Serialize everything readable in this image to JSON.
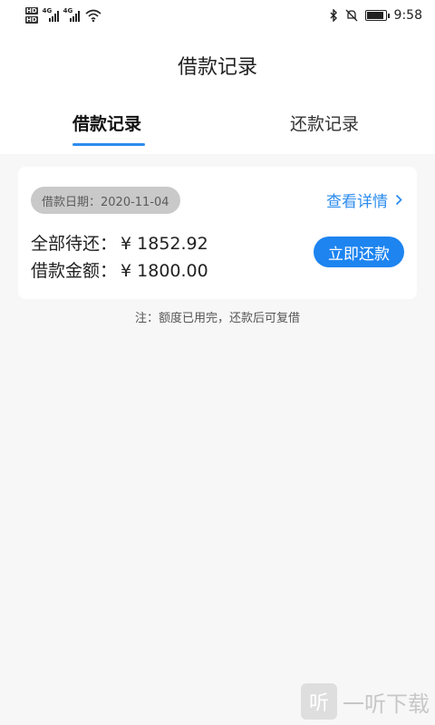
{
  "status_bar": {
    "time": "9:58",
    "left_icons": [
      "hd-icon",
      "signal-4g-icon",
      "signal-4g-icon",
      "wifi-icon"
    ],
    "right_icons": [
      "bluetooth-icon",
      "mute-bell-icon",
      "battery-icon"
    ],
    "network_label": "4G"
  },
  "header": {
    "title": "借款记录",
    "tabs": [
      {
        "label": "借款记录",
        "active": true
      },
      {
        "label": "还款记录",
        "active": false
      }
    ]
  },
  "loan_card": {
    "date_label": "借款日期：2020-11-04",
    "detail_link": "查看详情",
    "detail_icon": "chevron-right-icon",
    "outstanding_label": "全部待还：",
    "outstanding_value": "¥ 1852.92",
    "amount_label": "借款金额：",
    "amount_value": "¥ 1800.00",
    "repay_button": "立即还款"
  },
  "note": "注：额度已用完，还款后可复借",
  "watermark": {
    "logo_text": "听",
    "text": "一听下载"
  },
  "colors": {
    "accent": "#2c8cef",
    "button": "#1d84f0",
    "background": "#f7f7f7",
    "pill": "#c9c9c9"
  }
}
